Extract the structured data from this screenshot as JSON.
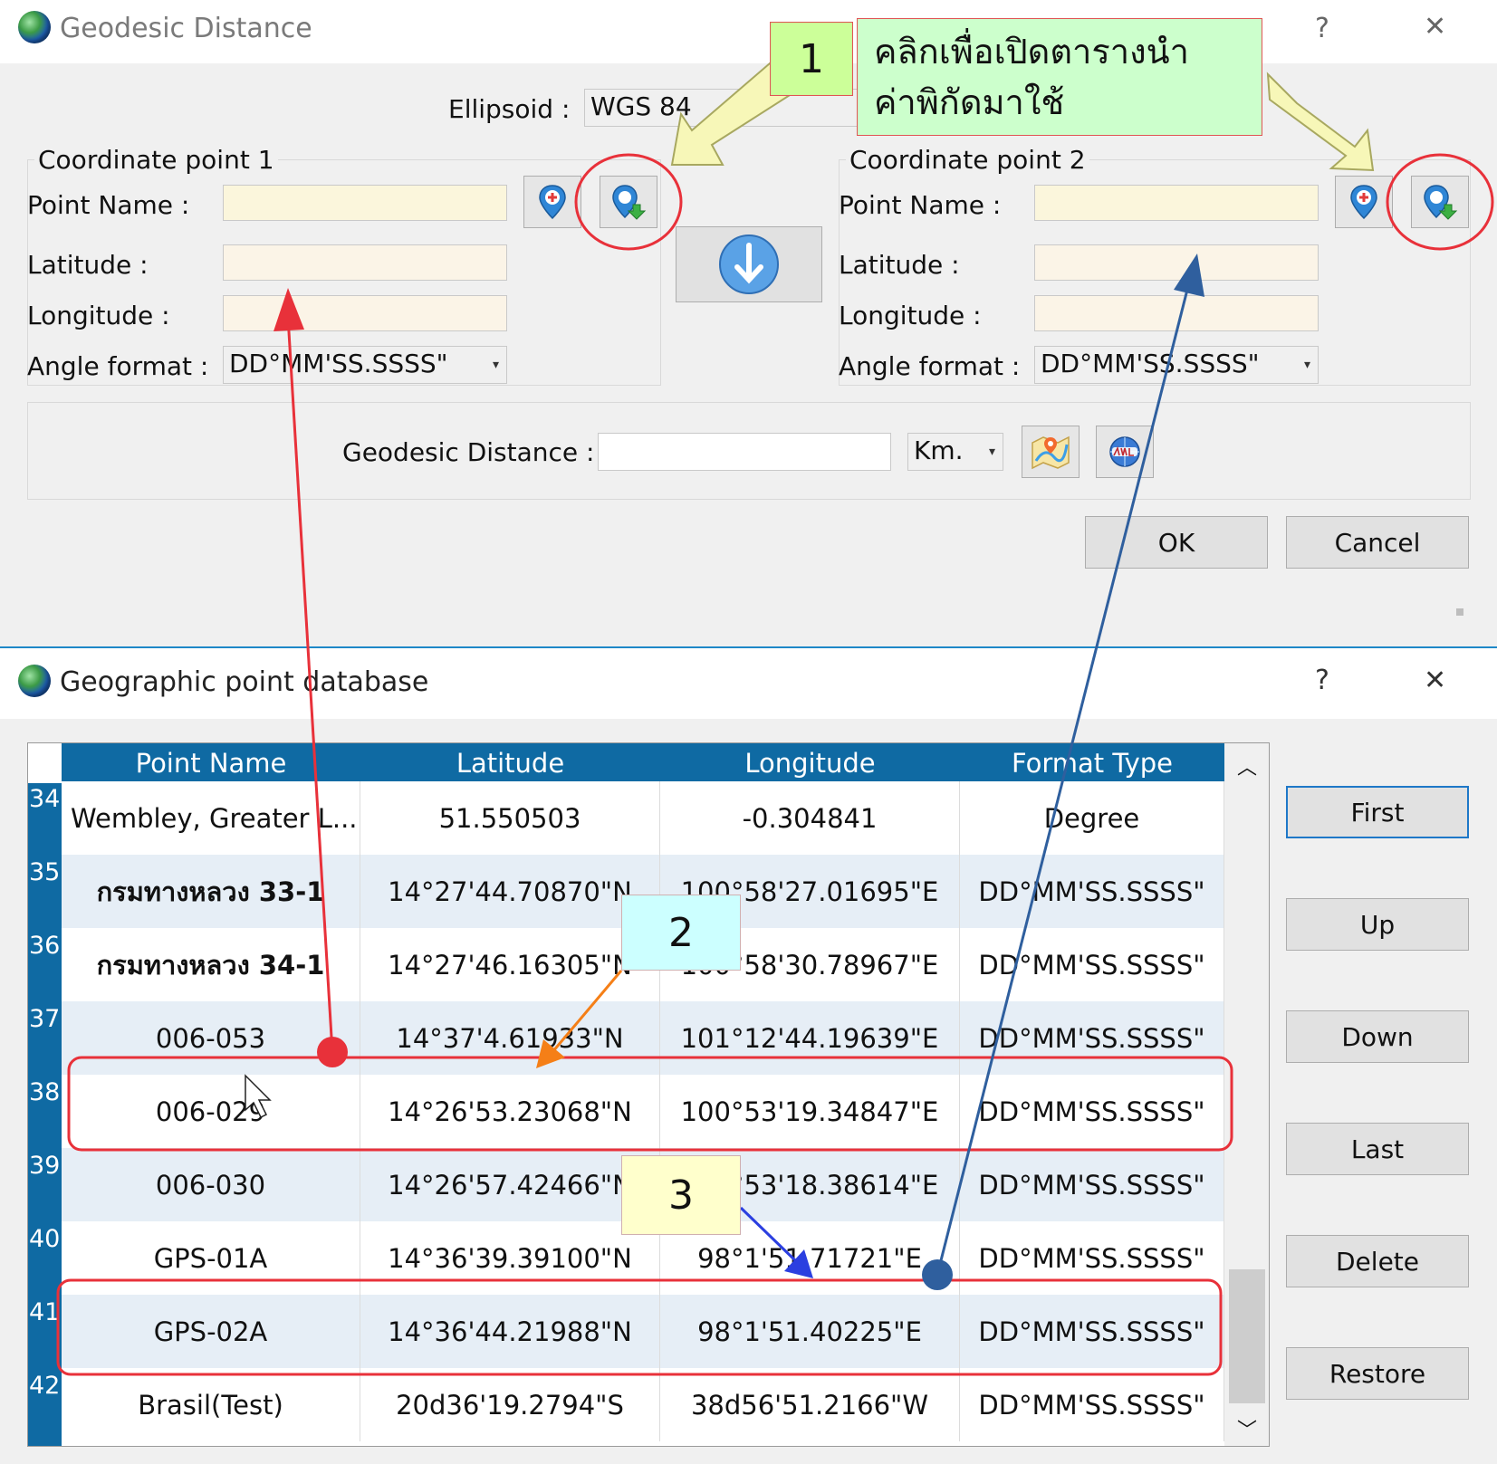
{
  "geodesic_dialog": {
    "title": "Geodesic Distance",
    "help": "?",
    "close": "✕",
    "ellipsoid_label": "Ellipsoid :",
    "ellipsoid_value": "WGS 84",
    "point1": {
      "group_label": "Coordinate point 1",
      "point_name_label": "Point Name :",
      "latitude_label": "Latitude :",
      "longitude_label": "Longitude :",
      "angle_format_label": "Angle format :",
      "angle_format_value": "DD°MM'SS.SSSS\""
    },
    "point2": {
      "group_label": "Coordinate point 2",
      "point_name_label": "Point Name :",
      "latitude_label": "Latitude :",
      "longitude_label": "Longitude :",
      "angle_format_label": "Angle format :",
      "angle_format_value": "DD°MM'SS.SSSS\""
    },
    "distance_label": "Geodesic Distance :",
    "distance_value": "",
    "unit_value": "Km.",
    "ok_label": "OK",
    "cancel_label": "Cancel"
  },
  "annotations": {
    "badge1": "1",
    "badge2": "2",
    "badge3": "3",
    "callout_line1": "คลิกเพื่อเปิดตารางนำ",
    "callout_line2": "ค่าพิกัดมาใช้"
  },
  "database_dialog": {
    "title": "Geographic point database",
    "help": "?",
    "close": "✕",
    "columns": [
      "Point Name",
      "Latitude",
      "Longitude",
      "Format Type"
    ],
    "rows": [
      {
        "num": "34",
        "name": "Wembley, Greater L...",
        "lat": "51.550503",
        "lon": "-0.304841",
        "fmt": "Degree"
      },
      {
        "num": "35",
        "name": "กรมทางหลวง 33-1",
        "lat": "14°27'44.70870\"N",
        "lon": "100°58'27.01695\"E",
        "fmt": "DD°MM'SS.SSSS\""
      },
      {
        "num": "36",
        "name": "กรมทางหลวง 34-1",
        "lat": "14°27'46.16305\"N",
        "lon": "100°58'30.78967\"E",
        "fmt": "DD°MM'SS.SSSS\""
      },
      {
        "num": "37",
        "name": "006-053",
        "lat": "14°37'4.61933\"N",
        "lon": "101°12'44.19639\"E",
        "fmt": "DD°MM'SS.SSSS\""
      },
      {
        "num": "38",
        "name": "006-029",
        "lat": "14°26'53.23068\"N",
        "lon": "100°53'19.34847\"E",
        "fmt": "DD°MM'SS.SSSS\""
      },
      {
        "num": "39",
        "name": "006-030",
        "lat": "14°26'57.42466\"N",
        "lon": "100°53'18.38614\"E",
        "fmt": "DD°MM'SS.SSSS\""
      },
      {
        "num": "40",
        "name": "GPS-01A",
        "lat": "14°36'39.39100\"N",
        "lon": "98°1'51.71721\"E",
        "fmt": "DD°MM'SS.SSSS\""
      },
      {
        "num": "41",
        "name": "GPS-02A",
        "lat": "14°36'44.21988\"N",
        "lon": "98°1'51.40225\"E",
        "fmt": "DD°MM'SS.SSSS\""
      },
      {
        "num": "42",
        "name": "Brasil(Test)",
        "lat": "20d36'19.2794\"S",
        "lon": "38d56'51.2166\"W",
        "fmt": "DD°MM'SS.SSSS\""
      }
    ],
    "buttons": {
      "first": "First",
      "up": "Up",
      "down": "Down",
      "last": "Last",
      "delete": "Delete",
      "restore": "Restore"
    }
  },
  "colors": {
    "header_blue": "#0f6aa3",
    "highlight_red": "#e8313a",
    "arrow_blue": "#2f5f9e",
    "callout_green": "#ccffcc"
  }
}
